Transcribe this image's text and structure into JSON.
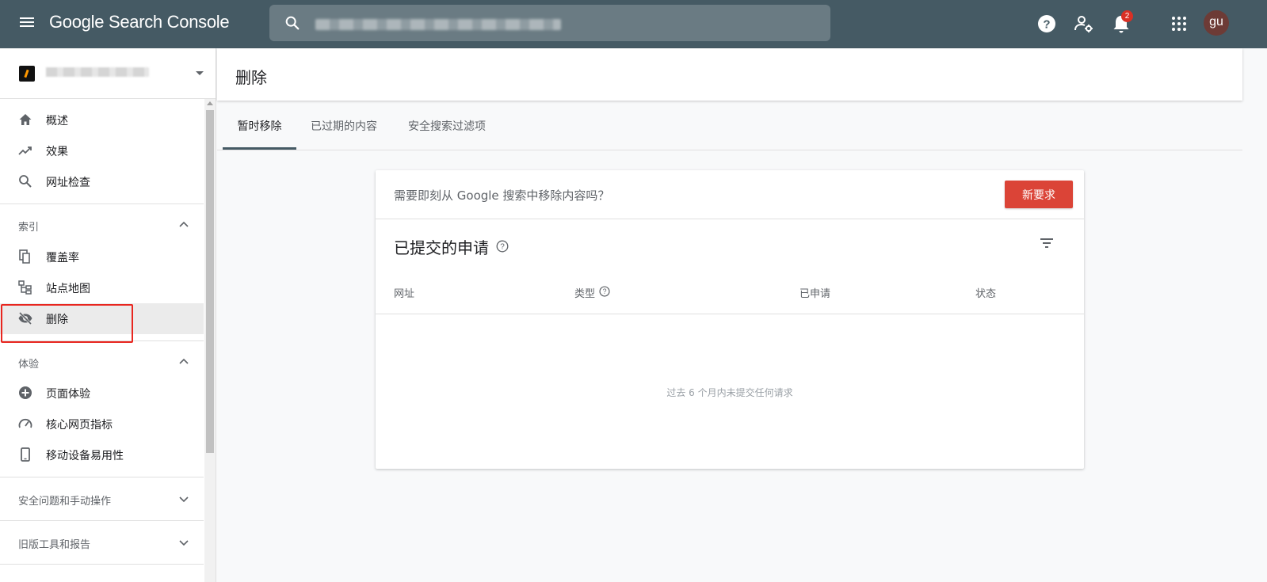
{
  "header": {
    "brand": "Google Search Console",
    "notification_count": "2",
    "avatar_initials": "gu"
  },
  "sidebar": {
    "nav_top": [
      {
        "label": "概述",
        "icon": "home-icon"
      },
      {
        "label": "效果",
        "icon": "trending-up-icon"
      },
      {
        "label": "网址检查",
        "icon": "search-icon"
      }
    ],
    "index_section": {
      "label": "索引",
      "items": [
        {
          "label": "覆盖率",
          "icon": "copy-icon"
        },
        {
          "label": "站点地图",
          "icon": "sitemap-icon"
        },
        {
          "label": "删除",
          "icon": "eye-off-icon",
          "active": true
        }
      ]
    },
    "experience_section": {
      "label": "体验",
      "items": [
        {
          "label": "页面体验",
          "icon": "add-circle-icon"
        },
        {
          "label": "核心网页指标",
          "icon": "speed-gauge-icon"
        },
        {
          "label": "移动设备易用性",
          "icon": "phone-icon"
        }
      ]
    },
    "security_section": {
      "label": "安全问题和手动操作"
    },
    "legacy_section": {
      "label": "旧版工具和报告"
    }
  },
  "page": {
    "title": "删除",
    "tabs": [
      {
        "label": "暂时移除",
        "active": true
      },
      {
        "label": "已过期的内容"
      },
      {
        "label": "安全搜索过滤项"
      }
    ]
  },
  "card": {
    "question": "需要即刻从 Google 搜索中移除内容吗？",
    "new_request_label": "新要求",
    "title": "已提交的申请",
    "columns": [
      "网址",
      "类型",
      "已申请",
      "状态"
    ],
    "empty_message": "过去 6 个月内未提交任何请求"
  },
  "colors": {
    "topbar": "#455a64",
    "accent_button": "#db4437",
    "badge": "#d93025",
    "highlight_border": "#e8261f"
  }
}
